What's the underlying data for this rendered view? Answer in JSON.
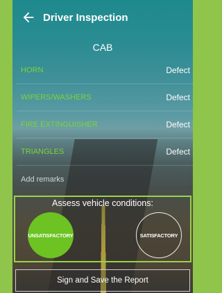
{
  "header": {
    "title": "Driver Inspection",
    "back_icon": "arrow-left-icon"
  },
  "section": {
    "title": "CAB"
  },
  "items": [
    {
      "label": "HORN",
      "status": "Defect"
    },
    {
      "label": "WIPERS/WASHERS",
      "status": "Defect"
    },
    {
      "label": "FIRE EXTINGUISHER",
      "status": "Defect"
    },
    {
      "label": "TRIANGLES",
      "status": "Defect"
    }
  ],
  "remarks": {
    "placeholder": "Add remarks"
  },
  "assess": {
    "title": "Assess vehicle conditions:",
    "unsatisfactory_label": "UNSATISFACTORY",
    "satisfactory_label": "SATISFACTORY",
    "selected": "UNSATISFACTORY"
  },
  "footer": {
    "sign_label": "Sign and Save the Report"
  },
  "colors": {
    "accent_green": "#6cc322",
    "label_green": "#7bd43a",
    "outer_border": "#8fc54a"
  }
}
